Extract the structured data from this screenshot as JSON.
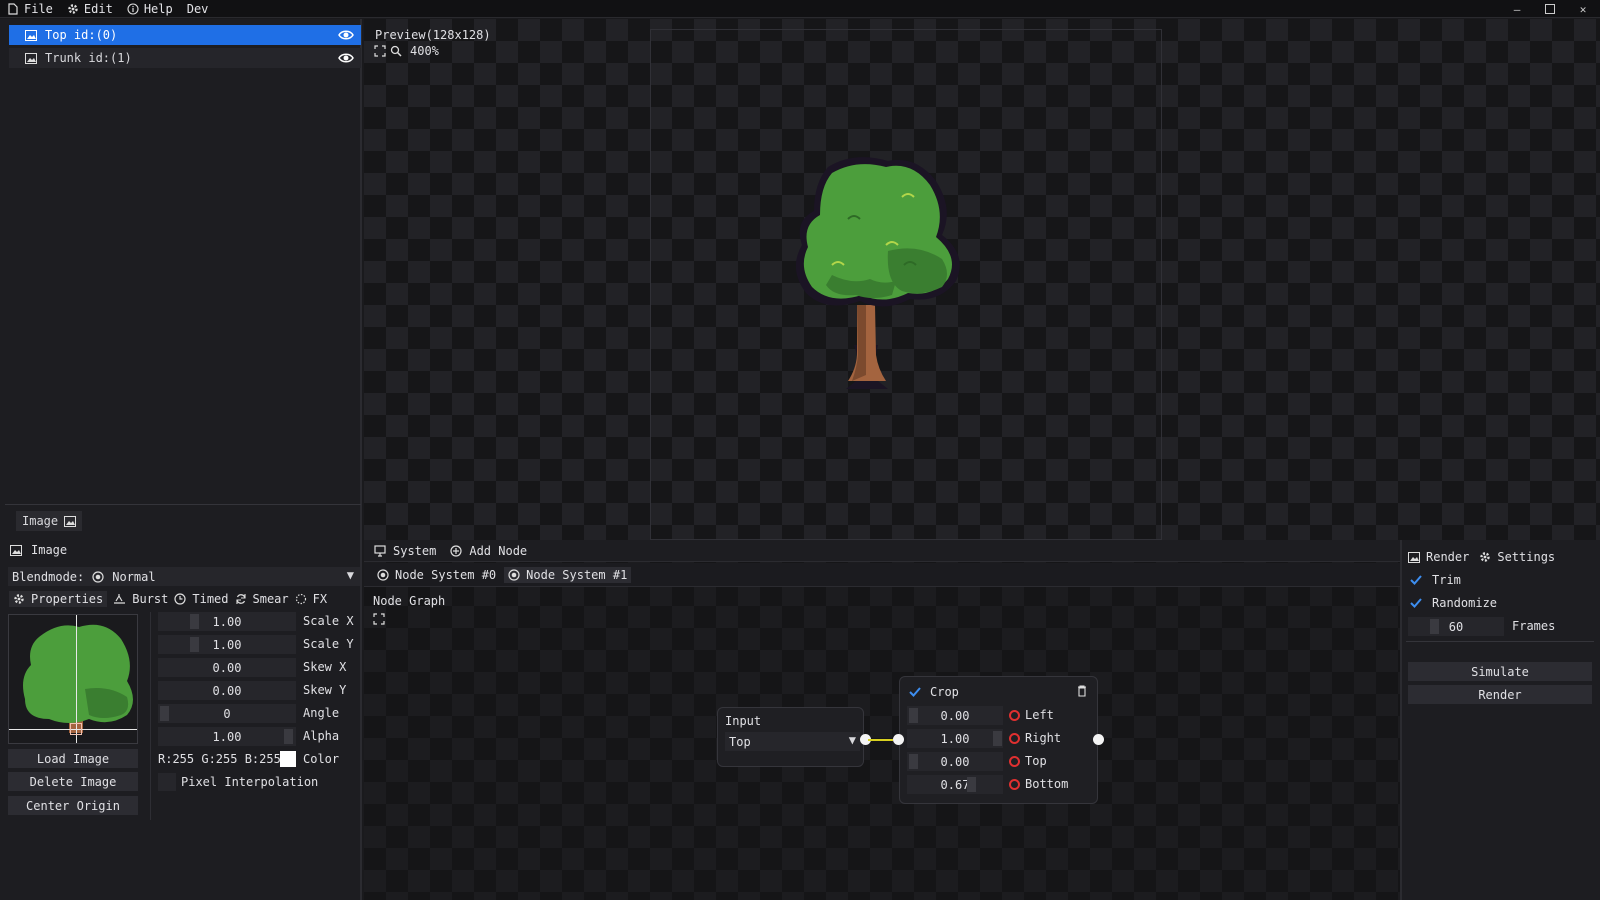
{
  "menu": {
    "file": "File",
    "edit": "Edit",
    "help": "Help",
    "dev": "Dev"
  },
  "layers": [
    {
      "label": "Top id:(0)",
      "selected": true
    },
    {
      "label": "Trunk id:(1)",
      "selected": false
    }
  ],
  "left_tab": "Image",
  "preview": {
    "title": "Preview(128x128)",
    "zoom": "400%"
  },
  "image_panel": {
    "header": "Image",
    "blendmode_label": "Blendmode:",
    "blendmode_value": "Normal",
    "tabs": [
      "Properties",
      "Burst",
      "Timed",
      "Smear",
      "FX"
    ],
    "props": [
      {
        "value": "1.00",
        "label": "Scale X"
      },
      {
        "value": "1.00",
        "label": "Scale Y"
      },
      {
        "value": "0.00",
        "label": "Skew X"
      },
      {
        "value": "0.00",
        "label": "Skew Y"
      },
      {
        "value": "0",
        "label": "Angle"
      },
      {
        "value": "1.00",
        "label": "Alpha"
      }
    ],
    "color_value": "R:255 G:255 B:255",
    "color_label": "Color",
    "pixel_interp": "Pixel Interpolation",
    "buttons": [
      "Load Image",
      "Delete Image",
      "Center Origin"
    ]
  },
  "node_panel": {
    "system": "System",
    "add_node": "Add Node",
    "tabs": [
      "Node System #0",
      "Node System #1"
    ],
    "graph_title": "Node Graph",
    "input_node": {
      "title": "Input",
      "value": "Top"
    },
    "crop_node": {
      "title": "Crop",
      "rows": [
        {
          "value": "0.00",
          "label": "Left"
        },
        {
          "value": "1.00",
          "label": "Right"
        },
        {
          "value": "0.00",
          "label": "Top"
        },
        {
          "value": "0.67",
          "label": "Bottom"
        }
      ]
    }
  },
  "render_panel": {
    "render_tab": "Render",
    "settings_tab": "Settings",
    "trim": "Trim",
    "randomize": "Randomize",
    "frames_value": "60",
    "frames_label": "Frames",
    "simulate": "Simulate",
    "render": "Render"
  },
  "colors": {
    "accent": "#1f6fe6",
    "check": "#3d8ef0",
    "red": "#e03030"
  }
}
